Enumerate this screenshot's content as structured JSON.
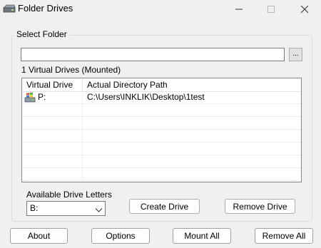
{
  "window": {
    "title": "Folder Drives"
  },
  "icons": {
    "app": "drive-icon",
    "minimize": "minimize-icon",
    "maximize": "maximize-icon",
    "close": "close-icon",
    "mounted_drive": "windows-drive-icon",
    "dropdown": "chevron-down-icon"
  },
  "folder_group": {
    "label": "Select Folder",
    "path_value": "",
    "browse_label": "..."
  },
  "drives_list": {
    "count_label": "1 Virtual Drives (Mounted)",
    "columns": [
      "Virtual Drive",
      "Actual Directory Path"
    ],
    "rows": [
      {
        "drive": "P:",
        "path": "C:\\Users\\INKLIK\\Desktop\\1test"
      }
    ]
  },
  "drive_letters": {
    "label": "Available Drive Letters",
    "selected": "B:"
  },
  "actions": {
    "create_drive": "Create Drive",
    "remove_drive": "Remove Drive"
  },
  "footer": {
    "about": "About",
    "options": "Options",
    "mount_all": "Mount All",
    "remove_all": "Remove All"
  }
}
